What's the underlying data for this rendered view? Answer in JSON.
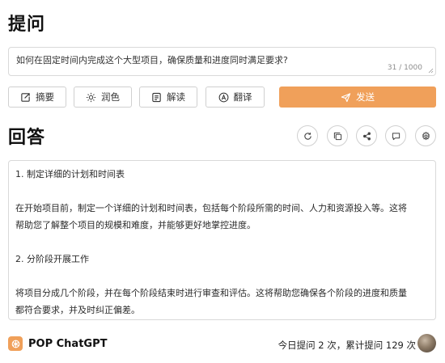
{
  "ask": {
    "title": "提问",
    "question": "如何在固定时间内完成这个大型项目，确保质量和进度同时满足要求?",
    "counter": "31 / 1000"
  },
  "toolbar": {
    "summary_label": "摘要",
    "polish_label": "润色",
    "read_label": "解读",
    "translate_label": "翻译",
    "send_label": "发送"
  },
  "answer": {
    "title": "回答",
    "lines": [
      "1. 制定详细的计划和时间表",
      "在开始项目前，制定一个详细的计划和时间表，包括每个阶段所需的时间、人力和资源投入等。这将",
      "帮助您了解整个项目的规模和难度，并能够更好地掌控进度。",
      "2. 分阶段开展工作",
      "将项目分成几个阶段，并在每个阶段结束时进行审查和评估。这将帮助您确保各个阶段的进度和质量",
      "都符合要求，并及时纠正偏差。"
    ]
  },
  "footer": {
    "brand": "POP ChatGPT",
    "stats": "今日提问 2 次，累计提问 129 次"
  },
  "colors": {
    "accent": "#f0a05a",
    "border": "#d9d9d9"
  }
}
